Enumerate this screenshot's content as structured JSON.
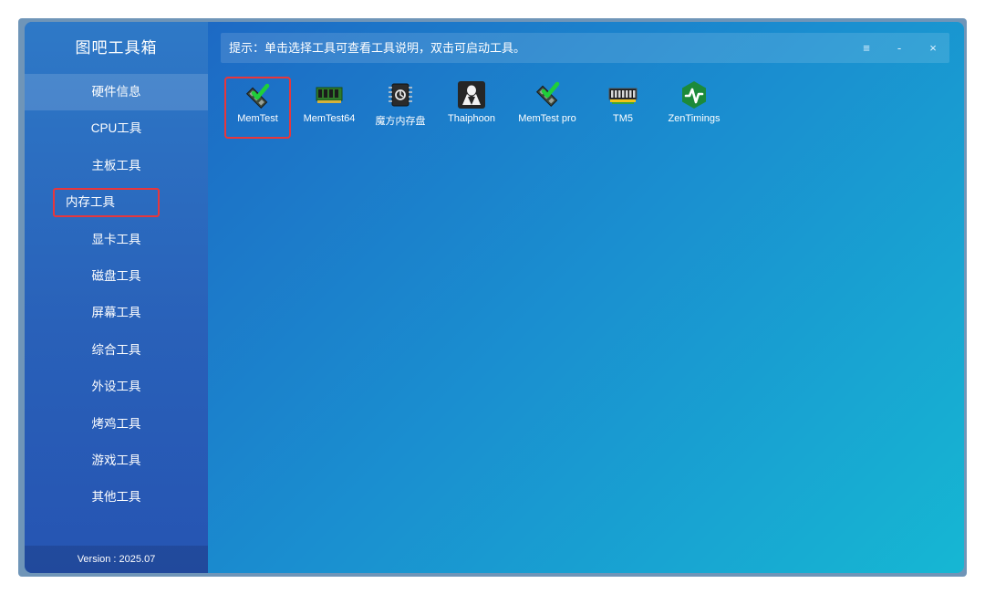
{
  "app": {
    "title": "图吧工具箱",
    "version": "Version : 2025.07"
  },
  "sidebar": {
    "items": [
      {
        "label": "硬件信息"
      },
      {
        "label": "CPU工具"
      },
      {
        "label": "主板工具"
      },
      {
        "label": "内存工具"
      },
      {
        "label": "显卡工具"
      },
      {
        "label": "磁盘工具"
      },
      {
        "label": "屏幕工具"
      },
      {
        "label": "综合工具"
      },
      {
        "label": "外设工具"
      },
      {
        "label": "烤鸡工具"
      },
      {
        "label": "游戏工具"
      },
      {
        "label": "其他工具"
      }
    ]
  },
  "tipbar": {
    "text": "提示：单击选择工具可查看工具说明，双击可启动工具。",
    "menu_symbol": "≡",
    "minimize_symbol": "-",
    "close_symbol": "×"
  },
  "tools": [
    {
      "label": "MemTest",
      "icon": "memtest-icon"
    },
    {
      "label": "MemTest64",
      "icon": "ram-stick-icon"
    },
    {
      "label": "魔方内存盘",
      "icon": "chip-icon"
    },
    {
      "label": "Thaiphoon",
      "icon": "thaiphoon-icon"
    },
    {
      "label": "MemTest pro",
      "icon": "memtest-pro-icon"
    },
    {
      "label": "TM5",
      "icon": "tm5-icon"
    },
    {
      "label": "ZenTimings",
      "icon": "zentimings-icon"
    }
  ],
  "colors": {
    "highlight_border": "#e8363b",
    "sidebar_top": "#2e79c7",
    "content_gradient_end": "#16b7d3"
  }
}
